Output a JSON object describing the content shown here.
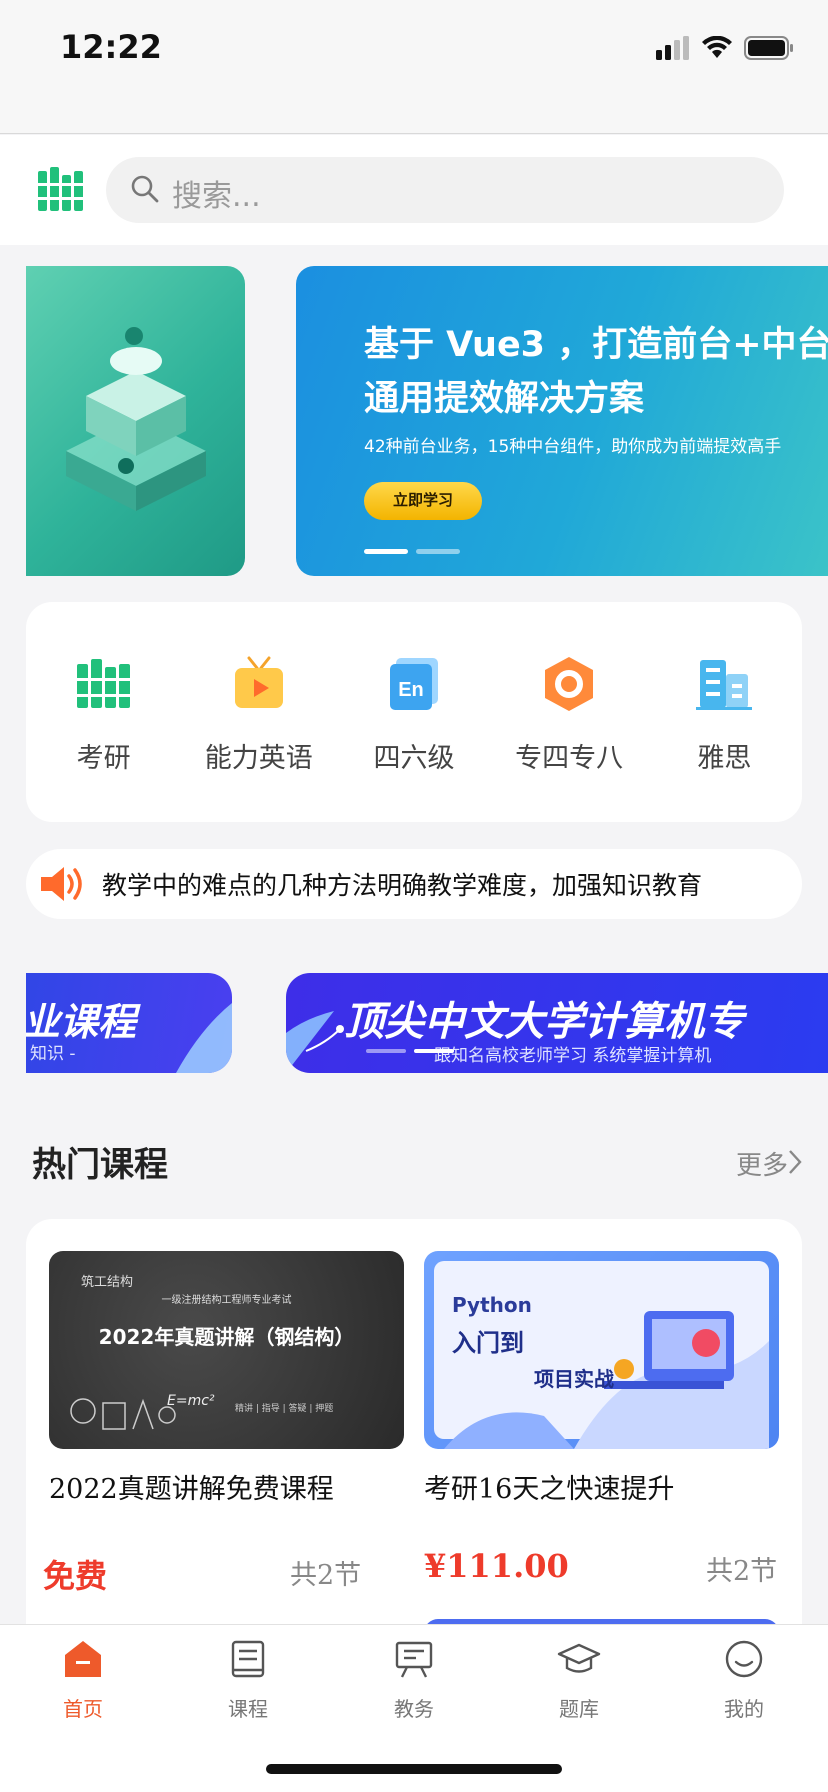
{
  "status_bar": {
    "time": "12:22"
  },
  "search": {
    "placeholder": "搜索..."
  },
  "banner": {
    "title_line1": "基于 Vue3 ，打造前台+中台",
    "title_line2": "通用提效解决方案",
    "subtitle": "42种前台业务，15种中台组件，助你成为前端提效高手",
    "button_label": "立即学习"
  },
  "categories": [
    {
      "label": "考研",
      "icon": "books-icon"
    },
    {
      "label": "能力英语",
      "icon": "tv-play-icon"
    },
    {
      "label": "四六级",
      "icon": "en-icon"
    },
    {
      "label": "专四专八",
      "icon": "hexagon-icon"
    },
    {
      "label": "雅思",
      "icon": "building-icon"
    }
  ],
  "notice": {
    "text": "教学中的难点的几种方法明确教学难度，加强知识教育"
  },
  "promo": {
    "left_title": "业课程",
    "left_sub": "知识 -",
    "main_title": "顶尖中文大学计算机专",
    "main_sub": "跟知名高校老师学习 系统掌握计算机"
  },
  "hot_courses": {
    "title": "热门课程",
    "more_label": "更多",
    "items": [
      {
        "name": "2022真题讲解免费课程",
        "price": "免费",
        "lessons": "共2节",
        "thumb": {
          "tag": "筑工结构",
          "heading": "一级注册结构工程师专业考试",
          "title": "2022年真题讲解（钢结构）",
          "footer": "精讲 | 指导 | 答疑 | 押题",
          "formula": "E=mc²"
        }
      },
      {
        "name": "考研16天之快速提升",
        "price": "¥111.00",
        "lessons": "共2节",
        "thumb": {
          "line1": "Python",
          "line2": "入门到",
          "line3": "项目实战"
        }
      }
    ]
  },
  "tabbar": [
    {
      "label": "首页",
      "icon": "home-icon",
      "active": true
    },
    {
      "label": "课程",
      "icon": "course-book-icon",
      "active": false
    },
    {
      "label": "教务",
      "icon": "board-icon",
      "active": false
    },
    {
      "label": "题库",
      "icon": "grad-cap-icon",
      "active": false
    },
    {
      "label": "我的",
      "icon": "smile-icon",
      "active": false
    }
  ],
  "colors": {
    "accent": "#ee5a2b",
    "price": "#ee3b2b",
    "green": "#21c07b"
  }
}
